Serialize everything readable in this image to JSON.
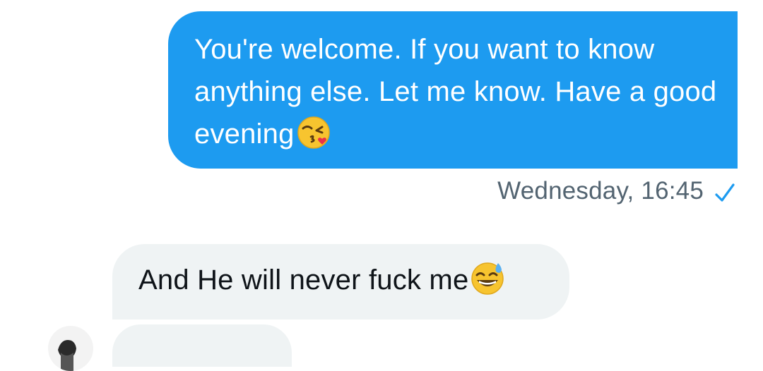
{
  "conversation": {
    "sent_message": {
      "text": "You're welcome. If you want to know anything else. Let me know. Have a good evening",
      "emoji_icon": "kissing-face-with-heart-icon",
      "timestamp": "Wednesday, 16:45",
      "status_icon": "sent-check-icon"
    },
    "received_message": {
      "text": "And He will never fuck me",
      "emoji_icon": "grinning-sweat-face-icon"
    }
  },
  "colors": {
    "sent_bubble": "#1d9bf0",
    "received_bubble": "#eff3f4",
    "timestamp": "#536471",
    "check": "#1d9bf0"
  }
}
